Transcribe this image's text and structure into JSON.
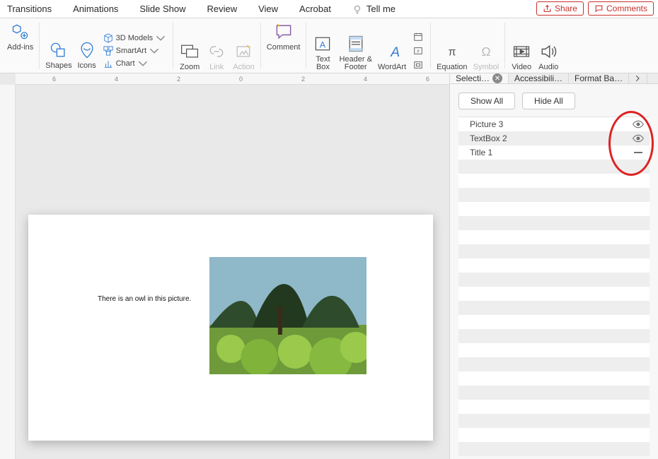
{
  "tabs": {
    "transitions": "Transitions",
    "animations": "Animations",
    "slideshow": "Slide Show",
    "review": "Review",
    "view": "View",
    "acrobat": "Acrobat",
    "tellme": "Tell me"
  },
  "top_right": {
    "share": "Share",
    "comments": "Comments"
  },
  "ribbon": {
    "addins": "Add-ins",
    "shapes": "Shapes",
    "icons": "Icons",
    "models3d": "3D Models",
    "smartart": "SmartArt",
    "chart": "Chart",
    "zoom": "Zoom",
    "link": "Link",
    "action": "Action",
    "comment": "Comment",
    "textbox": "Text\nBox",
    "headerfooter": "Header &\nFooter",
    "wordart": "WordArt",
    "equation": "Equation",
    "symbol": "Symbol",
    "video": "Video",
    "audio": "Audio"
  },
  "ruler_marks": [
    "6",
    "4",
    "2",
    "0",
    "2",
    "4",
    "6"
  ],
  "slide": {
    "caption": "There is an owl in this picture."
  },
  "side": {
    "tab_selection": "Selecti…",
    "tab_accessibility": "Accessibili…",
    "tab_format_bg": "Format Ba…",
    "show_all": "Show All",
    "hide_all": "Hide All",
    "items": [
      {
        "name": "Picture 3",
        "state": "visible"
      },
      {
        "name": "TextBox 2",
        "state": "visible"
      },
      {
        "name": "Title 1",
        "state": "hidden"
      }
    ]
  }
}
